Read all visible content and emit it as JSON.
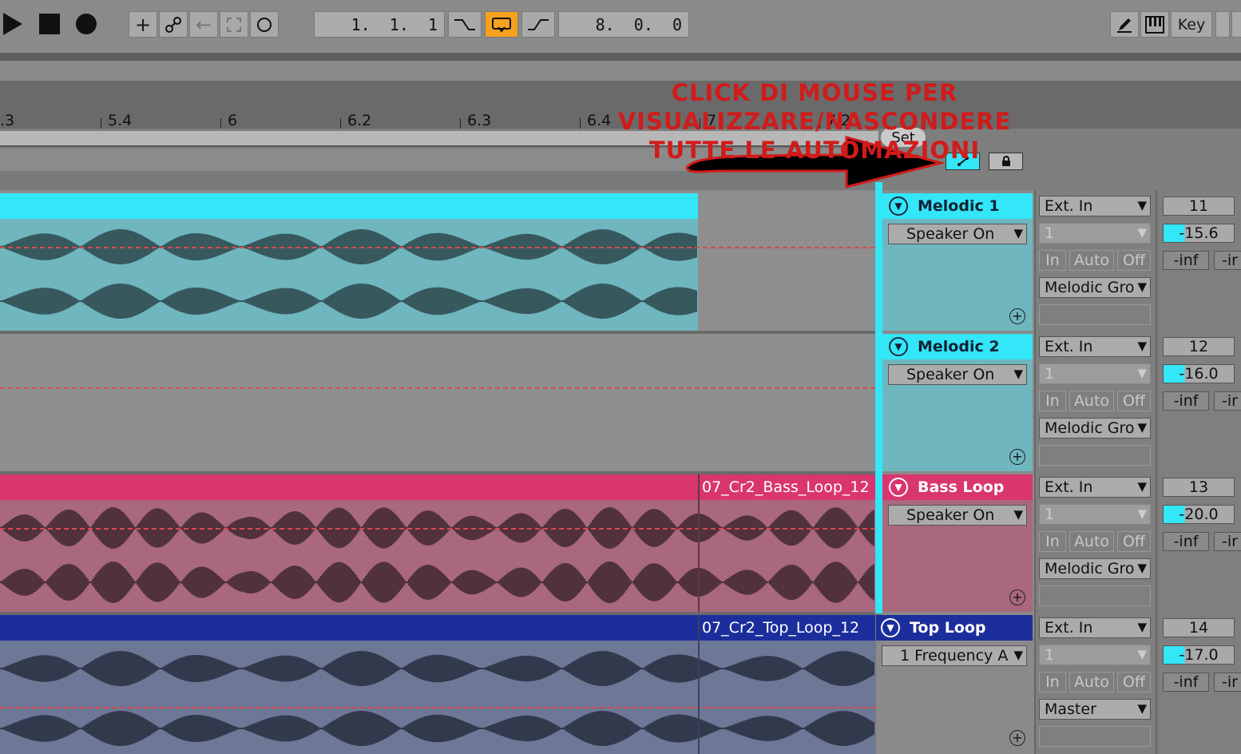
{
  "transport": {
    "position": "1.  1.  1",
    "loop_length": "8.  0.  0",
    "key_label": "Key"
  },
  "ruler": {
    "ticks": [
      ".3",
      "5.4",
      "6",
      "6.2",
      "6.3",
      "6.4",
      "7",
      "7.2"
    ]
  },
  "annotation": {
    "line1": "CLICK DI MOUSE PER VISUALIZZARE/NASCONDERE",
    "line2": "TUTTE LE AUTOMAZIONI"
  },
  "arrangement": {
    "set_label": "Set"
  },
  "tracks": [
    {
      "name": "Melodic 1",
      "clip_name": "",
      "color": "#33e6f8",
      "body_color": "#6fb6bf",
      "device": "Speaker On",
      "input": "Ext. In",
      "channel": "1",
      "monitor": [
        "In",
        "Auto",
        "Off"
      ],
      "output": "Melodic Gro",
      "number": "11",
      "volume": "-15.6",
      "pan": "-inf",
      "send": "-ir"
    },
    {
      "name": "Melodic 2",
      "clip_name": "",
      "color": "#33e6f8",
      "body_color": "#6fb6bf",
      "device": "Speaker On",
      "input": "Ext. In",
      "channel": "1",
      "monitor": [
        "In",
        "Auto",
        "Off"
      ],
      "output": "Melodic Gro",
      "number": "12",
      "volume": "-16.0",
      "pan": "-inf",
      "send": "-ir"
    },
    {
      "name": "Bass Loop",
      "clip_name": "07_Cr2_Bass_Loop_12",
      "color": "#d9356f",
      "body_color": "#a9687d",
      "device": "Speaker On",
      "input": "Ext. In",
      "channel": "1",
      "monitor": [
        "In",
        "Auto",
        "Off"
      ],
      "output": "Melodic Gro",
      "number": "13",
      "volume": "-20.0",
      "pan": "-inf",
      "send": "-ir"
    },
    {
      "name": "Top Loop",
      "clip_name": "07_Cr2_Top_Loop_12",
      "color": "#1c2e9c",
      "body_color": "#6d7796",
      "device": "1 Frequency A",
      "input": "Ext. In",
      "channel": "1",
      "monitor": [
        "In",
        "Auto",
        "Off"
      ],
      "output": "Master",
      "number": "14",
      "volume": "-17.0",
      "pan": "-inf",
      "send": "-ir"
    }
  ],
  "colors": {
    "accent_cyan": "#33e6f8",
    "loop_orange": "#f6a21e",
    "annotation_red": "#d11b1b"
  }
}
